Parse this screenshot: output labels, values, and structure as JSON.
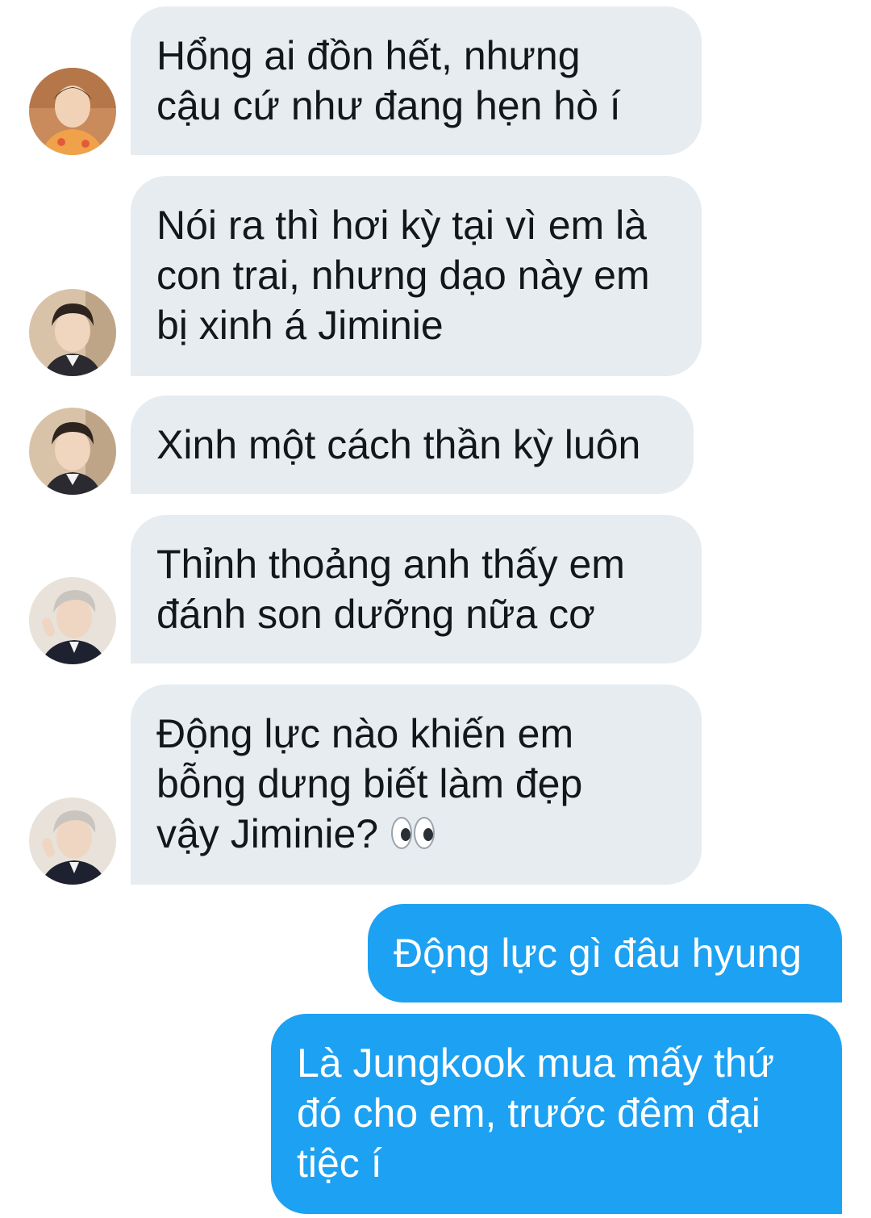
{
  "messages": [
    {
      "sender": "received",
      "avatar": "avatar-1",
      "lines": [
        "Hổng ai đồn hết, nhưng",
        "cậu cứ như đang hẹn hò í"
      ]
    },
    {
      "sender": "received",
      "avatar": "avatar-2",
      "lines": [
        "Nói ra thì hơi kỳ tại vì em là",
        "con trai, nhưng dạo này em",
        "bị xinh á Jiminie"
      ]
    },
    {
      "sender": "received",
      "avatar": "avatar-2",
      "lines": [
        "Xinh một cách thần kỳ luôn"
      ]
    },
    {
      "sender": "received",
      "avatar": "avatar-3",
      "lines": [
        "Thỉnh thoảng anh thấy em",
        "đánh son dưỡng nữa cơ"
      ]
    },
    {
      "sender": "received",
      "avatar": "avatar-3",
      "lines": [
        "Động lực nào khiến em",
        "bỗng dưng biết làm đẹp",
        "vậy Jiminie?"
      ],
      "trailing_emoji": "eyes-emoji"
    },
    {
      "sender": "sent",
      "lines": [
        "Động lực gì đâu hyung"
      ]
    },
    {
      "sender": "sent",
      "lines": [
        "Là Jungkook mua mấy thứ",
        "đó cho em, trước đêm đại",
        "tiệc í"
      ]
    }
  ],
  "colors": {
    "received_bubble": "#e6ecf0",
    "sent_bubble": "#1da1f2",
    "received_text": "#14171a",
    "sent_text": "#ffffff",
    "background": "#ffffff"
  }
}
